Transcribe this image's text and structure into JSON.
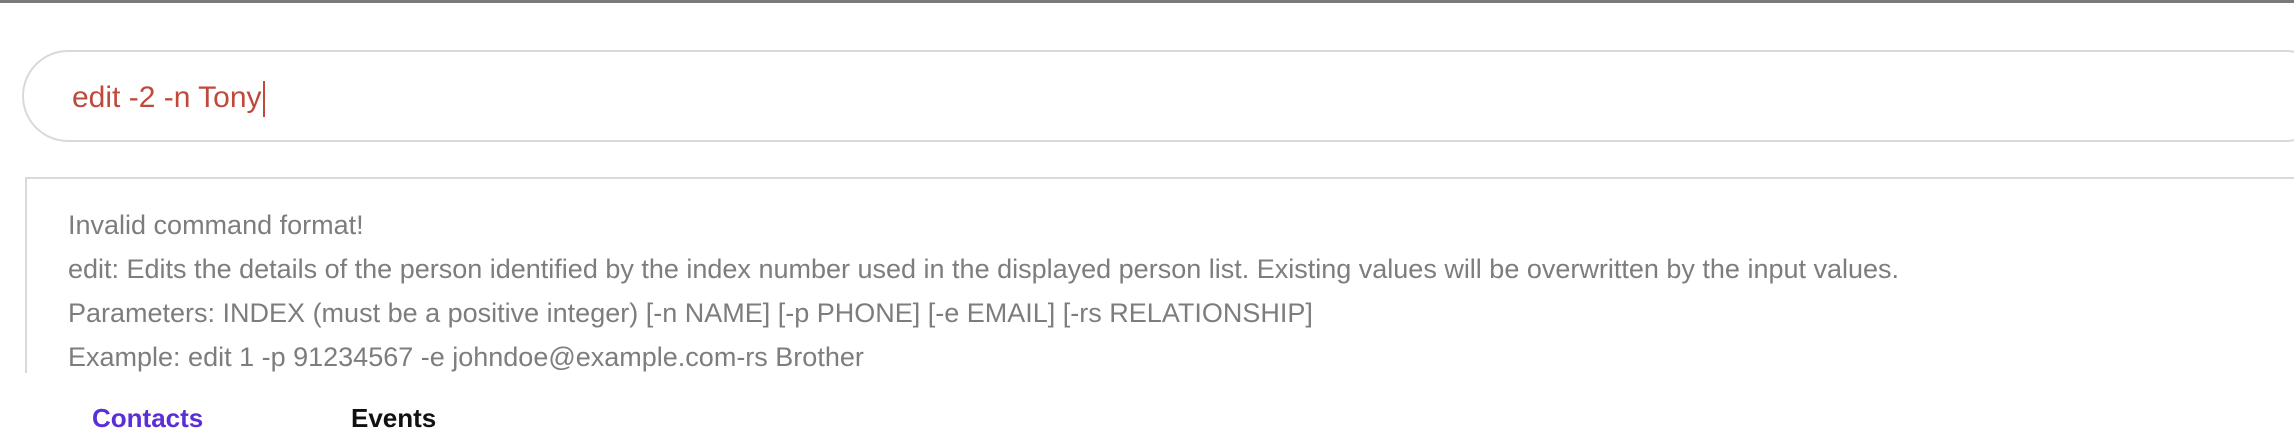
{
  "command_box": {
    "value": "edit -2 -n Tony",
    "text_color": "#c0493b"
  },
  "result_display": {
    "lines": [
      "Invalid command format!",
      "edit: Edits the details of the person identified by the index number used in the displayed person list. Existing values will be overwritten by the input values.",
      "Parameters: INDEX (must be a positive integer) [-n NAME] [-p PHONE] [-e EMAIL] [-rs RELATIONSHIP]",
      "Example: edit 1 -p 91234567 -e johndoe@example.com-rs Brother"
    ],
    "text_color": "#7d7d7d"
  },
  "tabs": [
    {
      "label": "Contacts",
      "selected": true,
      "color": "#5b2fd6"
    },
    {
      "label": "Events",
      "selected": false,
      "color": "#111111"
    }
  ]
}
